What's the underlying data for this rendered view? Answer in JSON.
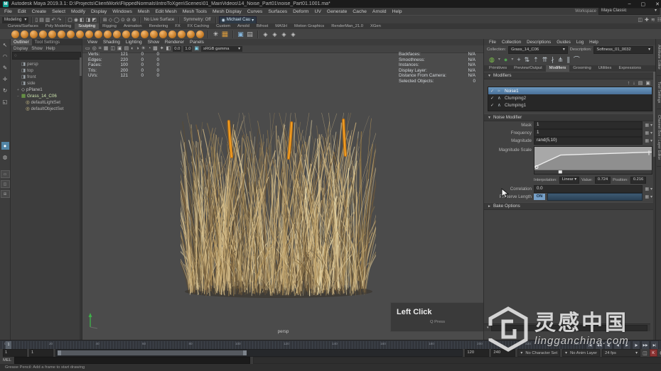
{
  "title_bar": {
    "app_icon": "M",
    "title": "Autodesk Maya 2019.3.1: D:\\Projects\\ClientWork\\FlippedNormals\\IntroToXgen\\Scenes\\01_MainVideos\\14_Noise_Part01\\noise_Part01.1001.ma*",
    "minimize": "–",
    "maximize": "▢",
    "close": "✕"
  },
  "menu_bar": {
    "items": [
      "File",
      "Edit",
      "Create",
      "Select",
      "Modify",
      "Display",
      "Windows",
      "Mesh",
      "Edit Mesh",
      "Mesh Tools",
      "Mesh Display",
      "Curves",
      "Surfaces",
      "Deform",
      "UV",
      "Generate",
      "Cache",
      "Arnold",
      "Help"
    ],
    "workspace_label": "Workspace",
    "workspace_value": "Maya Classic",
    "workspace_arrow": "▾"
  },
  "status_line": {
    "menuset": "Modeling",
    "menuset_arrow": "▾",
    "file_icons": [
      "▯",
      "▤",
      "▥"
    ],
    "undo_icons": [
      "↶",
      "↷"
    ],
    "mask_icons": [
      "▢",
      "◉",
      "◧",
      "◨",
      "◩"
    ],
    "snap_icons": [
      "⊞",
      "◇",
      "◯",
      "⊙",
      "⊘",
      "⊚"
    ],
    "live_surface": "No Live Surface",
    "symmetry": "Symmetry: Off",
    "user_icon": "◉",
    "user": "Michael Cau",
    "user_arrow": "▾",
    "right_icons": [
      "◫",
      "✚",
      "≋",
      "☷"
    ]
  },
  "shelf": {
    "tabs": [
      {
        "label": "Curves/Surfaces"
      },
      {
        "label": "Poly Modeling"
      },
      {
        "label": "Sculpting",
        "cls": "active"
      },
      {
        "label": "Rigging"
      },
      {
        "label": "Animation"
      },
      {
        "label": "Rendering"
      },
      {
        "label": "FX"
      },
      {
        "label": "FX Caching"
      },
      {
        "label": "Custom"
      },
      {
        "label": "Arnold"
      },
      {
        "label": "Bifrost"
      },
      {
        "label": "MASH"
      },
      {
        "label": "Motion Graphics"
      },
      {
        "label": "RenderMan_21.0"
      },
      {
        "label": "XGen"
      }
    ],
    "icons": [
      "ball",
      "ball",
      "ball",
      "ball",
      "ball",
      "ball",
      "ball",
      "ball",
      "ball",
      "ball",
      "ball",
      "ball",
      "ball",
      "ball",
      "ball",
      "ball",
      "ball",
      "ball",
      "ball",
      "ball",
      "ball",
      "sep",
      "snow",
      "gridic",
      "sep",
      "imga",
      "imgb",
      "sep",
      "cmb",
      "cmb",
      "cmb",
      "cmb"
    ]
  },
  "toolbox": {
    "tools": [
      {
        "g": "↖"
      },
      {
        "g": "◠"
      },
      {
        "g": "✎"
      },
      {
        "g": "✛"
      },
      {
        "g": "↻"
      },
      {
        "g": "◱"
      },
      {
        "g": "●",
        "cls": "activeTool gap"
      },
      {
        "g": "◍"
      }
    ],
    "layouts": [
      {
        "g": "▭"
      },
      {
        "g": "◫"
      },
      {
        "g": "⊞"
      }
    ]
  },
  "outliner": {
    "tabs": [
      {
        "label": "Outliner",
        "cls": "active"
      },
      {
        "label": "Tool Settings"
      }
    ],
    "menus": [
      "Display",
      "Show",
      "Help"
    ],
    "search_icon": "○",
    "items": [
      {
        "pre": "",
        "icon": "◨",
        "label": "persp",
        "cls": "cam"
      },
      {
        "pre": "",
        "icon": "◨",
        "label": "top",
        "cls": "cam"
      },
      {
        "pre": "",
        "icon": "◨",
        "label": "front",
        "cls": "cam"
      },
      {
        "pre": "",
        "icon": "◨",
        "label": "side",
        "cls": "cam"
      },
      {
        "pre": "+",
        "icon": "◇",
        "label": "pPlane1",
        "cls": "mesh"
      },
      {
        "pre": "−",
        "icon": "▦",
        "label": "Grass_14_C06",
        "cls": "coll"
      },
      {
        "pre": "",
        "icon": "◎",
        "label": "defaultLightSet",
        "cls": "set"
      },
      {
        "pre": "",
        "icon": "◎",
        "label": "defaultObjectSet",
        "cls": "set"
      }
    ]
  },
  "viewport": {
    "menus": [
      "View",
      "Shading",
      "Lighting",
      "Show",
      "Renderer",
      "Panels"
    ],
    "icons": [
      "▭",
      "◎",
      "⌗",
      "▦",
      "◫",
      "▣",
      "▤",
      "◐",
      "◑",
      "☀",
      "◔",
      "▩",
      "✦",
      "◧"
    ],
    "exposure": "0.0",
    "gamma": "1.0",
    "view_transform": "sRGB gamma",
    "vt_arrow": "▾",
    "hud_left": [
      {
        "l": "Verts:",
        "a": "121",
        "b": "0",
        "c": "0"
      },
      {
        "l": "Edges:",
        "a": "220",
        "b": "0",
        "c": "0"
      },
      {
        "l": "Faces:",
        "a": "100",
        "b": "0",
        "c": "0"
      },
      {
        "l": "Tris:",
        "a": "200",
        "b": "0",
        "c": "0"
      },
      {
        "l": "UVs:",
        "a": "121",
        "b": "0",
        "c": "0"
      }
    ],
    "hud_right": [
      {
        "l": "Backfaces:",
        "v": "N/A"
      },
      {
        "l": "Smoothness:",
        "v": "N/A"
      },
      {
        "l": "Instances:",
        "v": "N/A"
      },
      {
        "l": "Display Layer:",
        "v": "N/A"
      },
      {
        "l": "Distance From Camera:",
        "v": "N/A"
      },
      {
        "l": "Selected Objects:",
        "v": "0"
      }
    ],
    "camera_label": "persp",
    "overlay_title": "Left Click",
    "overlay_sub": "Q Press"
  },
  "xgen": {
    "menus": [
      "File",
      "Collection",
      "Descriptions",
      "Guides",
      "Log",
      "Help"
    ],
    "collection_label": "Collection:",
    "collection": "Grass_14_C06",
    "description_label": "Description:",
    "description": "Softness_01_0032",
    "drop_arrow": "▾",
    "toolbar_icons": [
      {
        "g": "◍",
        "cls": "g1"
      },
      {
        "g": "▾",
        "cls": "dim"
      },
      {
        "g": "●",
        "cls": "g2"
      },
      {
        "g": "▾",
        "cls": "dim"
      },
      {
        "g": "+"
      },
      {
        "g": "⇅"
      },
      {
        "g": "⇡"
      },
      {
        "g": "⇈"
      },
      {
        "g": "∤"
      },
      {
        "g": "⋔"
      },
      {
        "g": "∥"
      },
      {
        "g": "⌒"
      }
    ],
    "tabs": [
      {
        "label": "Primitives"
      },
      {
        "label": "Preview/Output"
      },
      {
        "label": "Modifiers",
        "cls": "active"
      },
      {
        "label": "Grooming"
      },
      {
        "label": "Utilities"
      },
      {
        "label": "Expressions"
      }
    ],
    "modifiers_header": "Modifiers",
    "list_tools": [
      "↑",
      "↓",
      "▤",
      "▣"
    ],
    "modifier_list": [
      {
        "check": "✓",
        "icon": "≈",
        "name": "Noise1",
        "cls": "sel"
      },
      {
        "check": "✓",
        "icon": "∧",
        "name": "Clumping2"
      },
      {
        "check": "✓",
        "icon": "∧",
        "name": "Clumping1"
      }
    ],
    "noise_header": "Noise Modifier",
    "fields": [
      {
        "label": "Mask",
        "value": "1"
      },
      {
        "label": "Frequency",
        "value": "1"
      },
      {
        "label": "Magnitude",
        "value": "rand(5,10)"
      }
    ],
    "map_icon": "▦",
    "field_arrow": "▾",
    "ramp_label": "Magnitude Scale",
    "interp_label": "Interpolation:",
    "interp_value": "Linear",
    "interp_arrow": "▾",
    "value_label": "Value:",
    "value": "0.724",
    "pos_label": "Position:",
    "pos": "0.216",
    "correlation_label": "Correlation",
    "correlation": "0.0",
    "preserve_label": "Preserve Length",
    "preserve_value": "ON",
    "bake_label": "Bake Options",
    "side_tabs": [
      "Attribute Editor",
      "Tool Settings",
      "Channel Box / Layer Editor"
    ]
  },
  "timeline": {
    "current": "1",
    "tick_labels": [
      "0",
      "20",
      "40",
      "60",
      "80",
      "100",
      "120",
      "140",
      "160",
      "180",
      "200",
      "220",
      "240"
    ],
    "transport": [
      "|◀",
      "◀◀",
      "◀|",
      "◀",
      "▶",
      "|▶",
      "▶▶",
      "▶|"
    ]
  },
  "range": {
    "start": "1",
    "playback_start": "1",
    "playback_end": "120",
    "end": "240",
    "character_set": "No Character Set",
    "anim_layer": "No Anim Layer",
    "fps": "24 fps",
    "drop_arrow": "▾",
    "autokey": "K"
  },
  "command_line": {
    "label": "MEL"
  },
  "help_line": {
    "text": "Grease Pencil: Add a frame to start drawing"
  },
  "watermark": {
    "title": "灵感中国",
    "url": "lingganchina.com"
  },
  "colors": {
    "selection_blue": "#5c86ad",
    "xgen_green": "#7ec24a",
    "guide_orange": "#ef9b16",
    "shelf_orange": "#cf8a33",
    "viewport_gray": "#4b4b4b",
    "panel_gray": "#424242"
  }
}
